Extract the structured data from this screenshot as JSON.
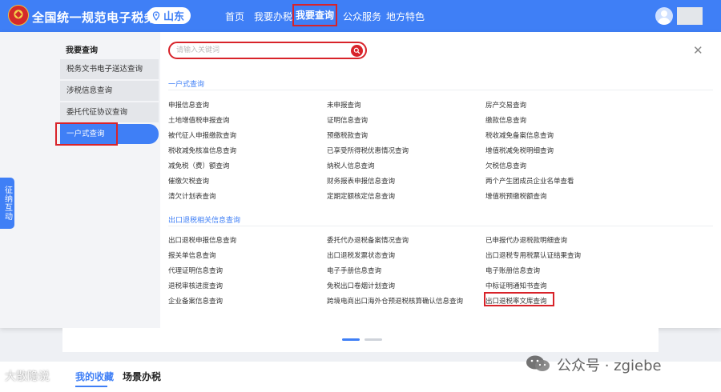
{
  "header": {
    "site_title": "全国统一规范电子税务局",
    "region": "山东",
    "nav": [
      "首页",
      "我要办税",
      "我要查询",
      "公众服务",
      "地方特色"
    ]
  },
  "sidebar": {
    "heading": "我要查询",
    "items": [
      "税务文书电子送达查询",
      "涉税信息查询",
      "委托代征协议查询",
      "一户式查询"
    ],
    "active_index": 3
  },
  "float_tab": "征纳互动",
  "search": {
    "placeholder": "请输入关键词"
  },
  "sections": [
    {
      "title": "一户式查询",
      "links": [
        "申报信息查询",
        "未申报查询",
        "房产交易查询",
        "土地增值税申报查询",
        "证明信息查询",
        "缴款信息查询",
        "被代征人申报缴款查询",
        "预缴税款查询",
        "税收减免备案信息查询",
        "税收减免核准信息查询",
        "已享受所得税优惠情况查询",
        "增值税减免税明细查询",
        "减免税（费）额查询",
        "纳税人信息查询",
        "欠税信息查询",
        "催缴欠税查询",
        "财务报表申报信息查询",
        "两个产生团成员企业名单查看",
        "清欠计划表查询",
        "定期定额核定信息查询",
        "增值税预缴税额查询"
      ]
    },
    {
      "title": "出口退税相关信息查询",
      "links": [
        "出口退税申报信息查询",
        "委托代办退税备案情况查询",
        "已申报代办退税款明细查询",
        "报关单信息查询",
        "出口退税发票状态查询",
        "出口退税专用税票认证结果查询",
        "代理证明信息查询",
        "电子手册信息查询",
        "电子账册信息查询",
        "退税审核进度查询",
        "免税出口卷烟计划查询",
        "中标证明通知书查询",
        "企业备案信息查询",
        "跨境电商出口海外仓预退税核算确认信息查询",
        "出口退税率文库查询"
      ]
    }
  ],
  "bottom_tabs": [
    "我的收藏",
    "场景办税"
  ],
  "watermarks": {
    "left": "大散隐说",
    "right": "公众号 · zgiebe"
  },
  "colors": {
    "brand_blue": "#3f7ff6",
    "highlight_red": "#d8232a"
  }
}
